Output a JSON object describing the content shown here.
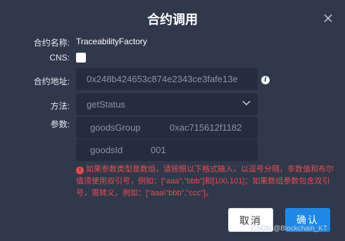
{
  "dialog": {
    "title": "合约调用",
    "close_icon": "close-icon"
  },
  "form": {
    "contract_name_label": "合约名称:",
    "contract_name_value": "TraceabilityFactory",
    "cns_label": "CNS:",
    "cns_checked": false,
    "address_label": "合约地址:",
    "address_value": "0x248b424653c874e2343ce3fafe13e",
    "address_info_icon": "info-icon",
    "method_label": "方法:",
    "method_value": "getStatus",
    "method_chevron_icon": "chevron-down-icon",
    "params_label": "参数:",
    "params": [
      {
        "name": "goodsGroup",
        "value": "0xac715612f1182"
      },
      {
        "name": "goodsId",
        "value": "001"
      }
    ]
  },
  "warning": {
    "icon": "alert-icon",
    "text": "如果参数类型是数组，请按照以下格式输入，以逗号分隔，非数值和布尔值须使用双引号，例如：[\"aaa\",\"bbb\"]和[100,101]；如果数组参数包含双引号，需转义，例如：[\"aaa\\\"bbb\",\"ccc\"]。"
  },
  "buttons": {
    "cancel_label": "取消",
    "confirm_label": "确认"
  },
  "watermark": "CSDN @Blockchain_KT",
  "colors": {
    "background": "#2f394b",
    "field_background": "#232d3d",
    "warning": "#ef4a4a",
    "primary": "#1e88e5"
  }
}
